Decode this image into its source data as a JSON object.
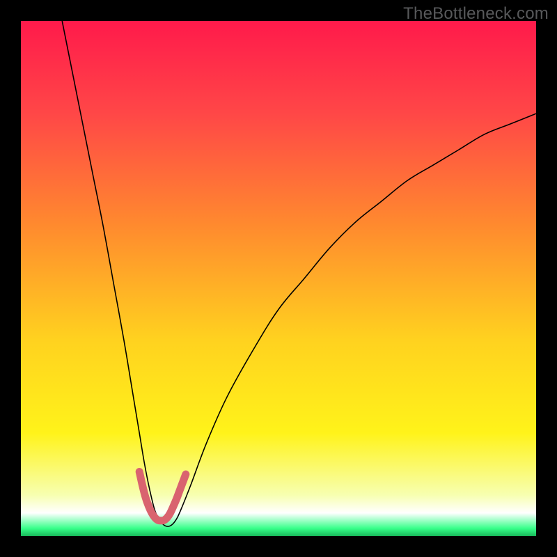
{
  "watermark": "TheBottleneck.com",
  "chart_data": {
    "type": "line",
    "title": "",
    "xlabel": "",
    "ylabel": "",
    "xlim": [
      0,
      100
    ],
    "ylim": [
      0,
      100
    ],
    "background_gradient": {
      "stops": [
        {
          "offset": 0.0,
          "color": "#ff1a4b"
        },
        {
          "offset": 0.18,
          "color": "#ff4747"
        },
        {
          "offset": 0.4,
          "color": "#ff8b2e"
        },
        {
          "offset": 0.62,
          "color": "#ffd21f"
        },
        {
          "offset": 0.8,
          "color": "#fff31a"
        },
        {
          "offset": 0.92,
          "color": "#f7ffb0"
        },
        {
          "offset": 0.955,
          "color": "#ffffff"
        },
        {
          "offset": 0.985,
          "color": "#37ff8a"
        },
        {
          "offset": 1.0,
          "color": "#18b85a"
        }
      ]
    },
    "series": [
      {
        "name": "bottleneck-curve",
        "stroke": "#000000",
        "stroke_width": 1.6,
        "x": [
          8,
          10,
          12,
          14,
          16,
          18,
          20,
          22,
          23,
          24,
          25,
          26,
          27,
          28,
          29,
          30,
          31,
          33,
          36,
          40,
          45,
          50,
          55,
          60,
          65,
          70,
          75,
          80,
          85,
          90,
          95,
          100
        ],
        "y": [
          100,
          90,
          80,
          70,
          60,
          49,
          38,
          26,
          20,
          14,
          9,
          5,
          3,
          2,
          2,
          3,
          5,
          10,
          18,
          27,
          36,
          44,
          50,
          56,
          61,
          65,
          69,
          72,
          75,
          78,
          80,
          82
        ]
      },
      {
        "name": "highlight-valley",
        "stroke": "#d9636f",
        "stroke_width": 11,
        "linecap": "round",
        "x": [
          23.0,
          23.6,
          24.2,
          24.8,
          25.4,
          26.0,
          26.6,
          27.2,
          27.8,
          28.4,
          29.0,
          29.6,
          30.2,
          30.8,
          31.4,
          32.0
        ],
        "y": [
          12.5,
          9.8,
          7.5,
          5.8,
          4.5,
          3.6,
          3.1,
          3.0,
          3.1,
          3.6,
          4.5,
          5.8,
          7.2,
          8.8,
          10.4,
          12.0
        ]
      }
    ]
  }
}
